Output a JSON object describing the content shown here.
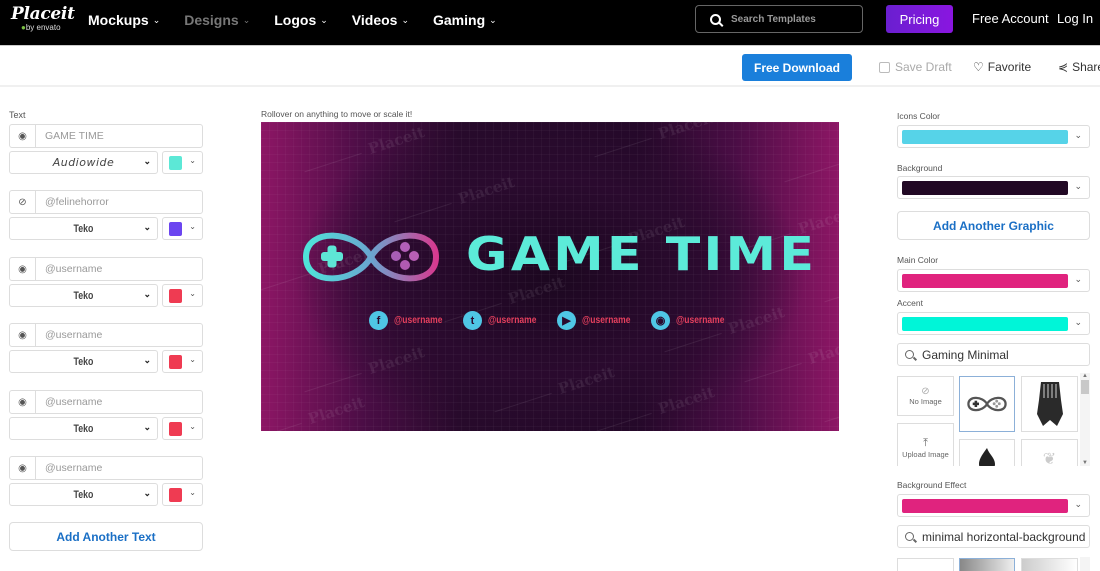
{
  "nav": {
    "logo": "Placeit",
    "logo_sub": "by envato",
    "links": [
      {
        "label": "Mockups",
        "dim": false
      },
      {
        "label": "Designs",
        "dim": true
      },
      {
        "label": "Logos",
        "dim": false
      },
      {
        "label": "Videos",
        "dim": false
      },
      {
        "label": "Gaming",
        "dim": false
      }
    ],
    "search_placeholder": "Search Templates",
    "pricing": "Pricing",
    "free_account": "Free Account",
    "login": "Log In"
  },
  "actions": {
    "download": "Free Download",
    "save_draft": "Save Draft",
    "favorite": "Favorite",
    "share": "Share"
  },
  "left": {
    "section_label": "Text",
    "texts": [
      {
        "value": "GAME TIME",
        "visible": true,
        "font": "Audiowide",
        "color": "#5ce8d6"
      },
      {
        "value": "@felinehorror",
        "visible": false,
        "font": "Teko",
        "color": "#6b45f0"
      },
      {
        "value": "@username",
        "visible": true,
        "font": "Teko",
        "color": "#ef3b52"
      },
      {
        "value": "@username",
        "visible": true,
        "font": "Teko",
        "color": "#ef3b52"
      },
      {
        "value": "@username",
        "visible": true,
        "font": "Teko",
        "color": "#ef3b52"
      },
      {
        "value": "@username",
        "visible": true,
        "font": "Teko",
        "color": "#ef3b52"
      }
    ],
    "add_text": "Add Another Text"
  },
  "canvas": {
    "hint": "Rollover on anything to move or scale it!",
    "title": "GAME TIME",
    "watermark": "Placeit",
    "socials": [
      {
        "icon": "facebook",
        "glyph": "f",
        "handle": "@username"
      },
      {
        "icon": "twitter",
        "glyph": "t",
        "handle": "@username"
      },
      {
        "icon": "youtube",
        "glyph": "▶",
        "handle": "@username"
      },
      {
        "icon": "discord",
        "glyph": "◉",
        "handle": "@username"
      }
    ]
  },
  "right": {
    "icons_color_label": "Icons Color",
    "icons_color": "#56d3e8",
    "background_label": "Background",
    "background": "#210824",
    "add_graphic": "Add Another Graphic",
    "main_color_label": "Main Color",
    "main_color": "#e0237e",
    "accent_label": "Accent",
    "accent": "#00f5d8",
    "graphic_search": "Gaming Minimal",
    "no_image": "No Image",
    "upload_image": "Upload Image",
    "bg_effect_label": "Background Effect",
    "bg_effect": "#e0237e",
    "bg_search": "minimal horizontal-background"
  }
}
